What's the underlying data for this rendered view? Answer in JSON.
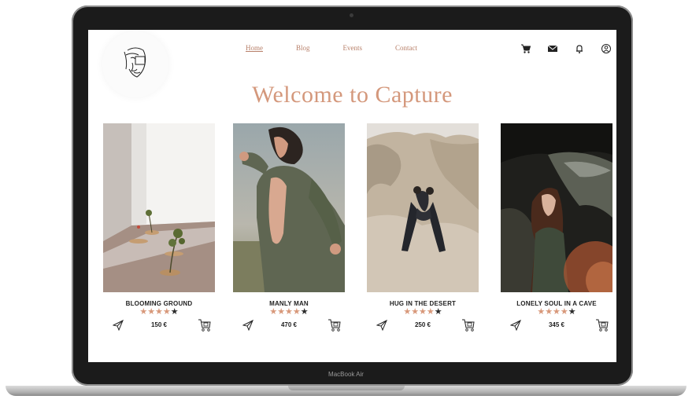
{
  "device": {
    "label": "MacBook Air"
  },
  "nav": {
    "items": [
      {
        "label": "Home",
        "active": true
      },
      {
        "label": "Blog",
        "active": false
      },
      {
        "label": "Events",
        "active": false
      },
      {
        "label": "Contact",
        "active": false
      }
    ]
  },
  "header_icons": [
    "cart-icon",
    "mail-icon",
    "bell-icon",
    "user-icon"
  ],
  "hero": {
    "title": "Welcome to Capture"
  },
  "colors": {
    "accent": "#d4987c",
    "star_on": "#d8987a",
    "star_off": "#2b2b2b"
  },
  "products": [
    {
      "name": "BLOOMING GROUND",
      "price": "150 €",
      "rating": 4,
      "max_rating": 5
    },
    {
      "name": "MANLY MAN",
      "price": "470 €",
      "rating": 4,
      "max_rating": 5
    },
    {
      "name": "HUG IN THE DESERT",
      "price": "250 €",
      "rating": 4,
      "max_rating": 5
    },
    {
      "name": "LONELY SOUL IN A CAVE",
      "price": "345 €",
      "rating": 4,
      "max_rating": 5
    }
  ]
}
